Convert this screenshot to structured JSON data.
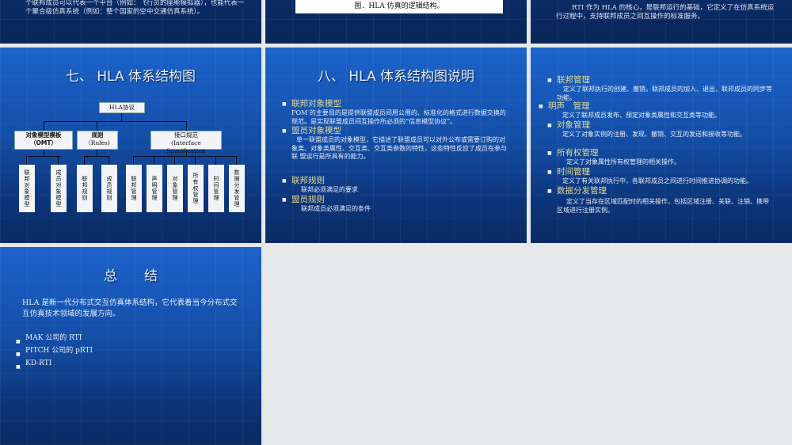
{
  "slides": [
    {
      "text": "个联邦成员可以代表一个平台（例如：飞行员的座舱模拟器），也能代表一个聚合级仿真系统（例如：整个国家的空中交通仿真系统）。"
    },
    {
      "caption": "图．HLA 仿真的逻辑结构。"
    },
    {
      "text": "RTI 作为 HLA 的核心，是联邦运行的基础，它定义了在仿真系统运行过程中，支持联邦成员之间互操作的标准服务。"
    },
    {
      "title": "七、 HLA 体系结构图",
      "root": "HLA协议",
      "groups": [
        {
          "l1": "对象模型模板",
          "l2": "（OMT）"
        },
        {
          "l1": "规则",
          "l2": "（Rules)"
        },
        {
          "l1": "接口规范",
          "l2": "(Interface Specification"
        }
      ],
      "leaves": [
        "联邦对象模型",
        "成员对象模型",
        "联邦规则",
        "成员规则",
        "联邦管理",
        "声明管理",
        "对象管理",
        "所有权管理",
        "时间管理",
        "数据分发管理"
      ]
    },
    {
      "title": "八、 HLA 体系结构图说明",
      "items": [
        {
          "h": "联邦对象模型",
          "d": "FOM 的主要目的是提供联盟成员间用公用的、标准化的格式进行数据交换的规范。是实现联盟成员间互操作所必须的“信息模型协议”。"
        },
        {
          "h": "盟员对象模型",
          "d": "单一联盟成员的对象模型，它描述了联盟成员可以对外公布或需要订购的对象类、对象类属性、交互类、交互类参数的特性，这些特性反应了成员在参与联 盟运行是所具有的能力。"
        },
        {
          "h": "联邦规则",
          "d": "联邦必须满足的要求"
        },
        {
          "h": "盟员规则",
          "d": "联邦成员必须满足的条件"
        }
      ]
    },
    {
      "items": [
        {
          "h": "联邦管理",
          "d": "定义了联邦执行的创建、撤销，联邦成员的加入、退出，联邦成员的同步等功能。"
        },
        {
          "h": "明声　管理",
          "d": "定义了联邦成员发布、预定对象类属性和交互类等功能。"
        },
        {
          "h": "对象管理",
          "d": "定义了对象实例的注册、发现、撤销、交互的发送和接收等功能。"
        },
        {
          "h": "所有权管理",
          "d": "定义了对象属性所有权管理的相关操作。"
        },
        {
          "h": "时间管理",
          "d": "定义了有关联邦执行中，各联邦成员之间进行时间推进协调的功能。"
        },
        {
          "h": "数据分发管理",
          "d": "定义了当存在区域匹配时的相关操作，包括区域注册、关联、注销、携带区域进行注册实例。"
        }
      ]
    },
    {
      "title": "总　　结",
      "text": "HLA 是新一代分布式交互仿真体系结构，它代表着当今分布式交互仿真技术领域的发展方向。",
      "items": [
        "MAK 公司的 RTI",
        "PITCH 公司的 pRTI",
        "KD-RTI"
      ]
    }
  ]
}
